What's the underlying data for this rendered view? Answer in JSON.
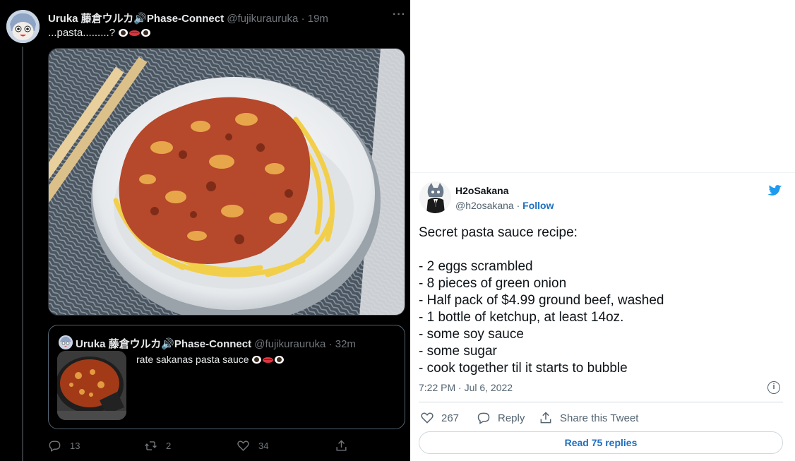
{
  "dark_tweet": {
    "author_name": "Uruka 藤倉ウルカ🔊Phase-Connect",
    "handle": "@fujikurauruka",
    "time": "· 19m",
    "text": "...pasta.........?",
    "photo_alt": "bowl of pasta with meat sauce",
    "quoted": {
      "author_name": "Uruka 藤倉ウルカ🔊Phase-Connect",
      "handle": "@fujikurauruka",
      "time": "· 32m",
      "text": "rate sakanas pasta sauce"
    },
    "actions": {
      "replies": "13",
      "retweets": "2",
      "likes": "34"
    },
    "more_icon": "more-dots-icon"
  },
  "light_tweet": {
    "author_name": "H2oSakana",
    "handle": "@h2osakana",
    "follow_label": "Follow",
    "separator": "·",
    "body": [
      "Secret pasta sauce recipe:",
      "",
      "- 2 eggs scrambled",
      "- 8 pieces of green onion",
      "- Half pack of $4.99 ground beef, washed",
      "- 1 bottle of ketchup, at least 14oz.",
      "- some soy sauce",
      "- some sugar",
      "- cook together til it starts to bubble"
    ],
    "timestamp": "7:22 PM · Jul 6, 2022",
    "info_icon": "i",
    "likes": "267",
    "reply_label": "Reply",
    "share_label": "Share this Tweet",
    "read_replies_label": "Read 75 replies",
    "brand_color": "#1d9bf0"
  }
}
